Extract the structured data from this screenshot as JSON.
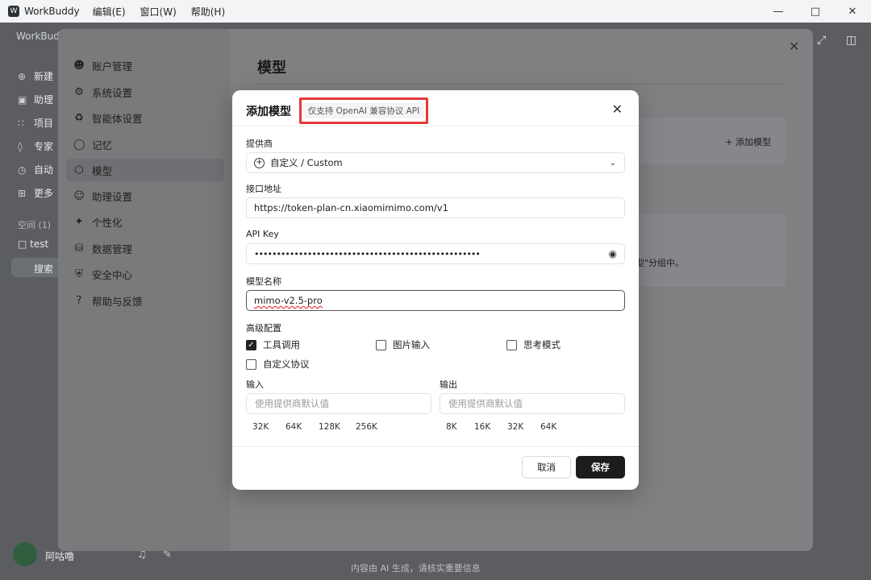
{
  "titlebar": {
    "app_name": "WorkBuddy",
    "menu": [
      "编辑(E)",
      "窗口(W)",
      "帮助(H)"
    ]
  },
  "background": {
    "brand": "WorkBudd",
    "nav": [
      "新建",
      "助理",
      "项目",
      "专家",
      "自动",
      "更多"
    ],
    "space": "空间 (1)",
    "folder": "test",
    "search": "搜索",
    "user": "阿咕噜",
    "footer": "内容由 AI 生成，请核实重要信息"
  },
  "settings": {
    "nav": [
      {
        "label": "账户管理",
        "icon": "user-icon"
      },
      {
        "label": "系统设置",
        "icon": "gear-icon"
      },
      {
        "label": "智能体设置",
        "icon": "puzzle-icon"
      },
      {
        "label": "记忆",
        "icon": "lightbulb-icon"
      },
      {
        "label": "模型",
        "icon": "cube-icon"
      },
      {
        "label": "助理设置",
        "icon": "assistant-icon"
      },
      {
        "label": "个性化",
        "icon": "sparkle-icon"
      },
      {
        "label": "数据管理",
        "icon": "database-icon"
      },
      {
        "label": "安全中心",
        "icon": "shield-icon"
      },
      {
        "label": "帮助与反馈",
        "icon": "help-icon"
      }
    ],
    "active_index": 4,
    "page_title": "模型",
    "add_model_label": "+ 添加模型",
    "note_fragment": "型\"分组中。"
  },
  "modal": {
    "title": "添加模型",
    "badge": "仅支持 OpenAI 兼容协议 API",
    "provider": {
      "label": "提供商",
      "value": "自定义 / Custom"
    },
    "endpoint": {
      "label": "接口地址",
      "value": "https://token-plan-cn.xiaomimimo.com/v1"
    },
    "api_key": {
      "label": "API Key",
      "value": "•••••••••••••••••••••••••••••••••••••••••••••••••••"
    },
    "model_name": {
      "label": "模型名称",
      "value": "mimo-v2.5-pro"
    },
    "advanced": {
      "label": "高级配置",
      "options": [
        {
          "label": "工具调用",
          "checked": true
        },
        {
          "label": "图片输入",
          "checked": false
        },
        {
          "label": "思考模式",
          "checked": false
        },
        {
          "label": "自定义协议",
          "checked": false
        }
      ]
    },
    "input": {
      "label": "输入",
      "placeholder": "使用提供商默认值",
      "chips": [
        "32K",
        "64K",
        "128K",
        "256K"
      ]
    },
    "output": {
      "label": "输出",
      "placeholder": "使用提供商默认值",
      "chips": [
        "8K",
        "16K",
        "32K",
        "64K"
      ]
    },
    "cancel_label": "取消",
    "save_label": "保存"
  }
}
